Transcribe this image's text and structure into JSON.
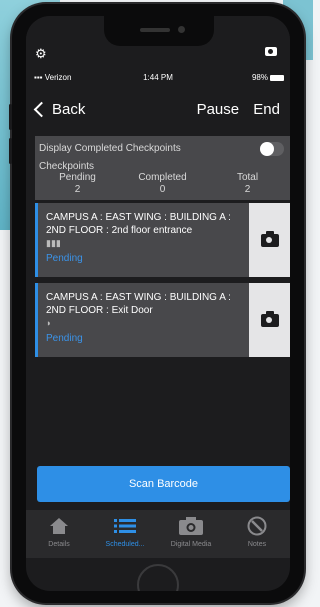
{
  "status_bar": {
    "carrier": "Verizon",
    "time": "1:44 PM",
    "battery": "98%"
  },
  "nav": {
    "back_label": "Back",
    "pause_label": "Pause",
    "end_label": "End"
  },
  "summary": {
    "display_completed_label": "Display Completed Checkpoints",
    "display_completed_on": false,
    "checkpoints_label": "Checkpoints",
    "pending_label": "Pending",
    "pending_count": "2",
    "completed_label": "Completed",
    "completed_count": "0",
    "total_label": "Total",
    "total_count": "2"
  },
  "checkpoints": [
    {
      "location": "CAMPUS A : EAST WING : BUILDING A : 2ND FLOOR : 2nd floor entrance",
      "type_icon": "barcode-icon",
      "status": "Pending"
    },
    {
      "location": "CAMPUS A : EAST WING : BUILDING A : 2ND FLOOR : Exit Door",
      "type_icon": "nfc-icon",
      "status": "Pending"
    }
  ],
  "scan_button_label": "Scan Barcode",
  "tabs": [
    {
      "label": "Details",
      "icon": "home-icon",
      "active": false
    },
    {
      "label": "Scheduled...",
      "icon": "list-icon",
      "active": true
    },
    {
      "label": "Digital Media",
      "icon": "camera-icon",
      "active": false
    },
    {
      "label": "Notes",
      "icon": "notes-icon",
      "active": false
    }
  ],
  "colors": {
    "accent": "#2e8fe6",
    "background": "#1c1c1e",
    "card": "#48484b"
  }
}
